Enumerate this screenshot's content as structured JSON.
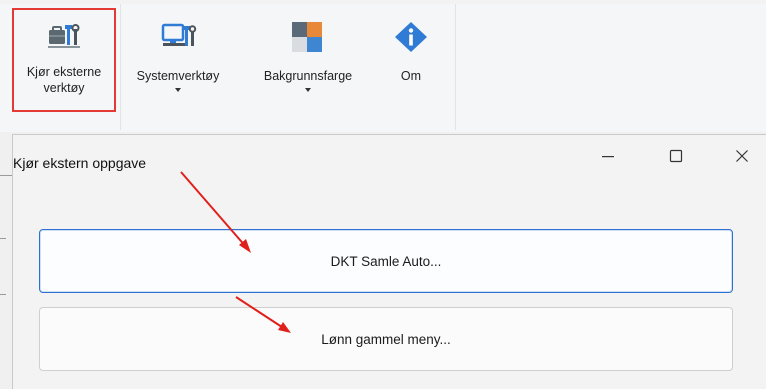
{
  "ribbon": {
    "buttons": [
      {
        "label_line1": "Kjør eksterne",
        "label_line2": "verktøy",
        "icon": "toolbox-icon",
        "selected": true
      },
      {
        "label": "Systemverktøy",
        "icon": "computer-tools-icon",
        "has_dropdown": true
      },
      {
        "label": "Bakgrunnsfarge",
        "icon": "color-squares-icon",
        "has_dropdown": true
      },
      {
        "label": "Om",
        "icon": "info-icon"
      }
    ]
  },
  "dialog": {
    "title": "Kjør ekstern oppgave",
    "controls": [
      "minimize-icon",
      "maximize-icon",
      "close-icon"
    ],
    "tasks": [
      {
        "label": "DKT Samle Auto..."
      },
      {
        "label": "Lønn gammel meny..."
      }
    ]
  },
  "colors": {
    "selection_border": "#e53935",
    "annotation_arrow": "#e0201b",
    "focus_border": "#2f6fd0"
  }
}
